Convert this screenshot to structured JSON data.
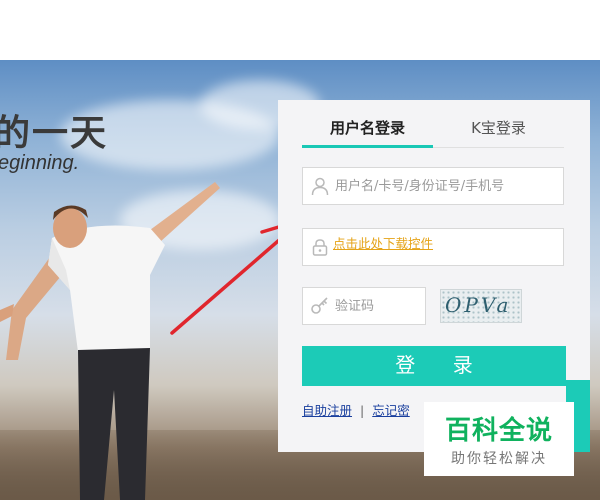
{
  "hero": {
    "slogan_cn": "的一天",
    "slogan_en": "eginning."
  },
  "login": {
    "tabs": [
      {
        "label": "用户名登录",
        "active": true
      },
      {
        "label": "K宝登录",
        "active": false
      }
    ],
    "username": {
      "placeholder": "用户名/卡号/身份证号/手机号",
      "value": ""
    },
    "password": {
      "plugin_link": "点击此处下载控件"
    },
    "captcha": {
      "placeholder": "验证码",
      "value": "",
      "image_text": "OPVa"
    },
    "submit_label": "登 录",
    "links": [
      {
        "label": "自助注册"
      },
      {
        "label": "忘记密"
      }
    ],
    "separator": "|"
  },
  "watermark": {
    "title": "百科全说",
    "subtitle": "助你轻松解决"
  },
  "colors": {
    "accent": "#1ccbb7",
    "link": "#1a3f9e",
    "plugin_link": "#e5a317",
    "arrow": "#e0262d",
    "watermark_green": "#10b25e"
  },
  "icons": {
    "username": "user-icon",
    "password": "lock-icon",
    "captcha": "key-icon"
  }
}
